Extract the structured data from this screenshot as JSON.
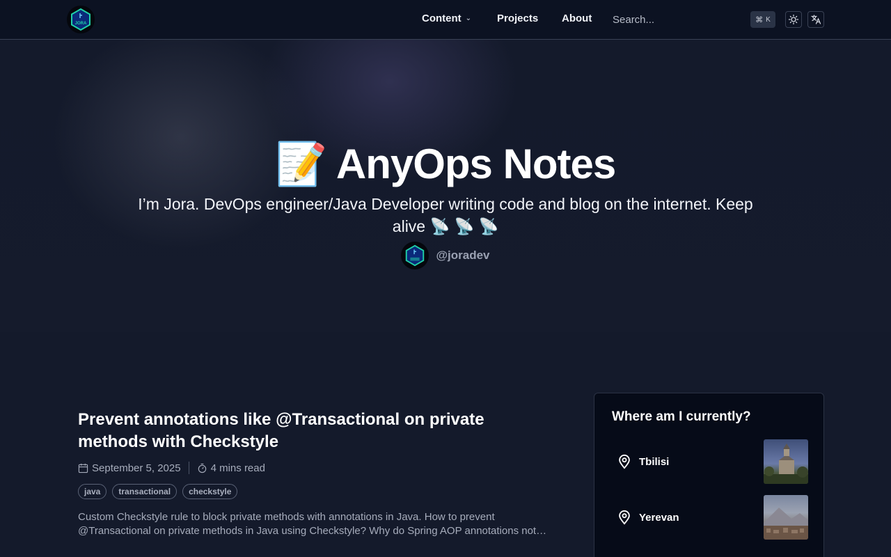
{
  "header": {
    "logo_text": "JORA",
    "nav": {
      "content": "Content",
      "projects": "Projects",
      "about": "About"
    },
    "search": {
      "placeholder": "Search..."
    },
    "shortcut": {
      "symbol": "⌘",
      "key": "K"
    },
    "icons": [
      "sun-icon",
      "translate-icon",
      "chevron-down-icon"
    ]
  },
  "hero": {
    "title": "📝 AnyOps Notes",
    "subtitle": "I’m Jora. DevOps engineer/Java Developer writing code and blog on the internet. Keep alive 📡 📡 📡",
    "handle": "@joradev"
  },
  "post": {
    "title": "Prevent annotations like @Transactional on private methods with Checkstyle",
    "date": "September 5, 2025",
    "read_time": "4 mins read",
    "tags": [
      "java",
      "transactional",
      "checkstyle"
    ],
    "excerpt": "Custom Checkstyle rule to block private methods with annotations in Java. How to prevent @Transactional on private methods in Java using Checkstyle? Why do Spring AOP annotations not…"
  },
  "location_card": {
    "title": "Where am I currently?",
    "locations": [
      {
        "name": "Tbilisi"
      },
      {
        "name": "Yerevan"
      }
    ]
  },
  "colors": {
    "background": "#141a2b",
    "header": "#0c1222",
    "card": "#060b18",
    "logo_accent": "#1fd1a8"
  }
}
